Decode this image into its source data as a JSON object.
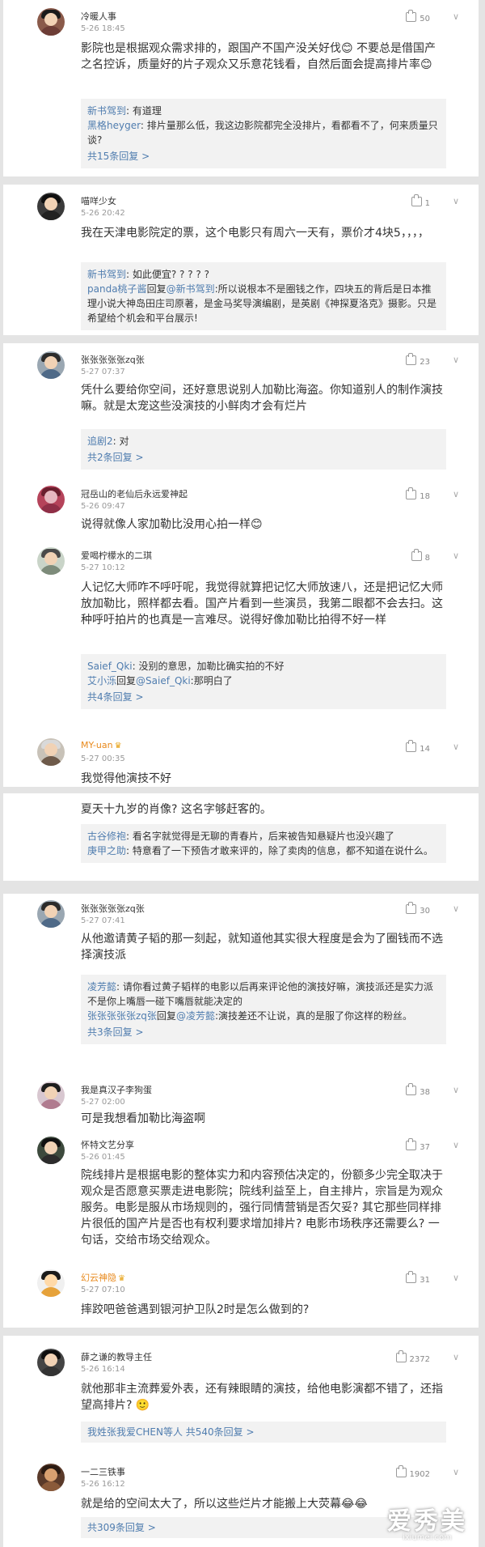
{
  "comments": [
    {
      "user": "冷暖人事",
      "time": "5-26 18:45",
      "likes": "50",
      "text": "影院也是根据观众需求排的，跟国产不国产没关好伐😊 不要总是借国产之名控诉，质量好的片子观众又乐意花钱看，自然后面会提高排片率😊",
      "replies": [
        {
          "name": "新书驾到",
          "sep": ": ",
          "text": "有道理"
        },
        {
          "name": "黑格heyger",
          "sep": ": ",
          "text": "排片量那么低，我这边影院都完全没排片，看都看不了，何来质量只谈?"
        }
      ],
      "more": "共15条回复 >"
    },
    {
      "user": "喵咩少女",
      "time": "5-26 20:42",
      "likes": "1",
      "text": "我在天津电影院定的票，这个电影只有周六一天有，票价才4块5，，，，",
      "replies": [
        {
          "name": "新书驾到",
          "sep": ": ",
          "text": "如此便宜? ? ? ? ?"
        },
        {
          "name": "panda桃子酱",
          "mid": "回复",
          "to": "@新书驾到",
          "sep": ":",
          "text": "所以说根本不是圈钱之作，四块五的背后是日本推理小说大神岛田庄司原著，是金马奖导演编剧，是英剧《神探夏洛克》摄影。只是希望给个机会和平台展示!"
        }
      ],
      "more": ""
    },
    {
      "user": "张张张张张zq张",
      "time": "5-27 07:37",
      "likes": "23",
      "text": "凭什么要给你空间，还好意思说别人加勒比海盗。你知道别人的制作演技嘛。就是太宠这些没演技的小鲜肉才会有烂片",
      "replies": [
        {
          "name": "追剧2",
          "sep": ": ",
          "text": "对"
        }
      ],
      "more": "共2条回复 >"
    },
    {
      "user": "冠岳山的老仙后永远爱神起",
      "time": "5-26 09:47",
      "likes": "18",
      "text": "说得就像人家加勒比没用心拍一样😊",
      "replies": [],
      "more": ""
    },
    {
      "user": "爱喝柠檬水的二琪",
      "time": "5-27 10:12",
      "likes": "8",
      "text": "人记忆大师咋不呼吁呢，我觉得就算把记忆大师放速八，还是把记忆大师放加勒比，照样都去看。国产片看到一些演员，我第二眼都不会去扫。这种呼吁拍片的也真是一言难尽。说得好像加勒比拍得不好一样",
      "replies": [
        {
          "name": "Saief_Qki",
          "sep": ": ",
          "text": "没别的意思，加勒比确实拍的不好"
        },
        {
          "name": "艾小泺",
          "mid": "回复",
          "to": "@Saief_Qki",
          "sep": ":",
          "text": "那明白了"
        }
      ],
      "more": "共4条回复 >"
    },
    {
      "user": "MY-uan",
      "time": "5-27 00:35",
      "likes": "14",
      "text": "我觉得他演技不好",
      "replies": [],
      "more": ""
    },
    {
      "user": "",
      "time": "",
      "likes": "",
      "text": "夏天十九岁的肖像? 这名字够赶客的。",
      "replies": [
        {
          "name": "古谷修袍",
          "sep": ": ",
          "text": "看名字就觉得是无聊的青春片，后来被告知悬疑片也没兴趣了"
        },
        {
          "name": "庚甲之助",
          "sep": ": ",
          "text": "特意看了一下预告才敢来评的，除了卖肉的信息，都不知道在说什么。"
        }
      ],
      "more": ""
    },
    {
      "user": "张张张张张zq张",
      "time": "5-27 07:41",
      "likes": "30",
      "text": "从他邀请黄子韬的那一刻起，就知道他其实很大程度是会为了圈钱而不选择演技派",
      "replies": [
        {
          "name": "凌芳懿",
          "sep": ": ",
          "text": "请你看过黄子韬样的电影以后再来评论他的演技好嘛，演技派还是实力派不是你上嘴唇一碰下嘴唇就能决定的"
        },
        {
          "name": "张张张张张zq张",
          "mid": "回复",
          "to": "@凌芳懿",
          "sep": ":",
          "text": "演技差还不让说，真的是服了你这样的粉丝。"
        }
      ],
      "more": "共3条回复 >"
    },
    {
      "user": "我是真汉子李狗蛋",
      "time": "5-27 02:00",
      "likes": "38",
      "text": "可是我想看加勒比海盗啊",
      "replies": [],
      "more": ""
    },
    {
      "user": "怀特文艺分享",
      "time": "5-26 01:45",
      "likes": "37",
      "text": "院线排片是根据电影的整体实力和内容预估决定的，份额多少完全取决于观众是否愿意买票走进电影院；院线利益至上，自主排片，宗旨是为观众服务。电影是服从市场规则的，强行同情营销是否欠妥? 其它那些同样排片很低的国产片是否也有权利要求增加排片? 电影市场秩序还需要么? 一句话，交给市场交给观众。",
      "replies": [],
      "more": ""
    },
    {
      "user": "幻云神隐",
      "time": "5-27 07:10",
      "likes": "31",
      "text": "摔跤吧爸爸遇到银河护卫队2时是怎么做到的?",
      "replies": [],
      "more": ""
    },
    {
      "user": "薛之谦的教导主任",
      "time": "5-26 16:14",
      "likes": "2372",
      "text": "就他那非主流葬爱外表，还有辣眼睛的演技，给他电影演都不错了，还指望高排片? 🙂",
      "replies": [
        {
          "name": "",
          "sep": "",
          "text": "",
          "rich": true
        }
      ],
      "more": "我姓张我爱CHEN等人 共540条回复 >"
    },
    {
      "user": "一二三铁事",
      "time": "5-26 16:12",
      "likes": "1902",
      "text": "就是给的空间太大了，所以这些烂片才能搬上大荧幕😂😂",
      "replies": [],
      "more": "共309条回复 >"
    }
  ],
  "watermark": {
    "big": "爱秀美",
    "small": "ixiumei.com"
  },
  "colors": {
    "link": "#507daf",
    "background": "#e4e4e4",
    "replyBg": "#f2f2f2"
  }
}
